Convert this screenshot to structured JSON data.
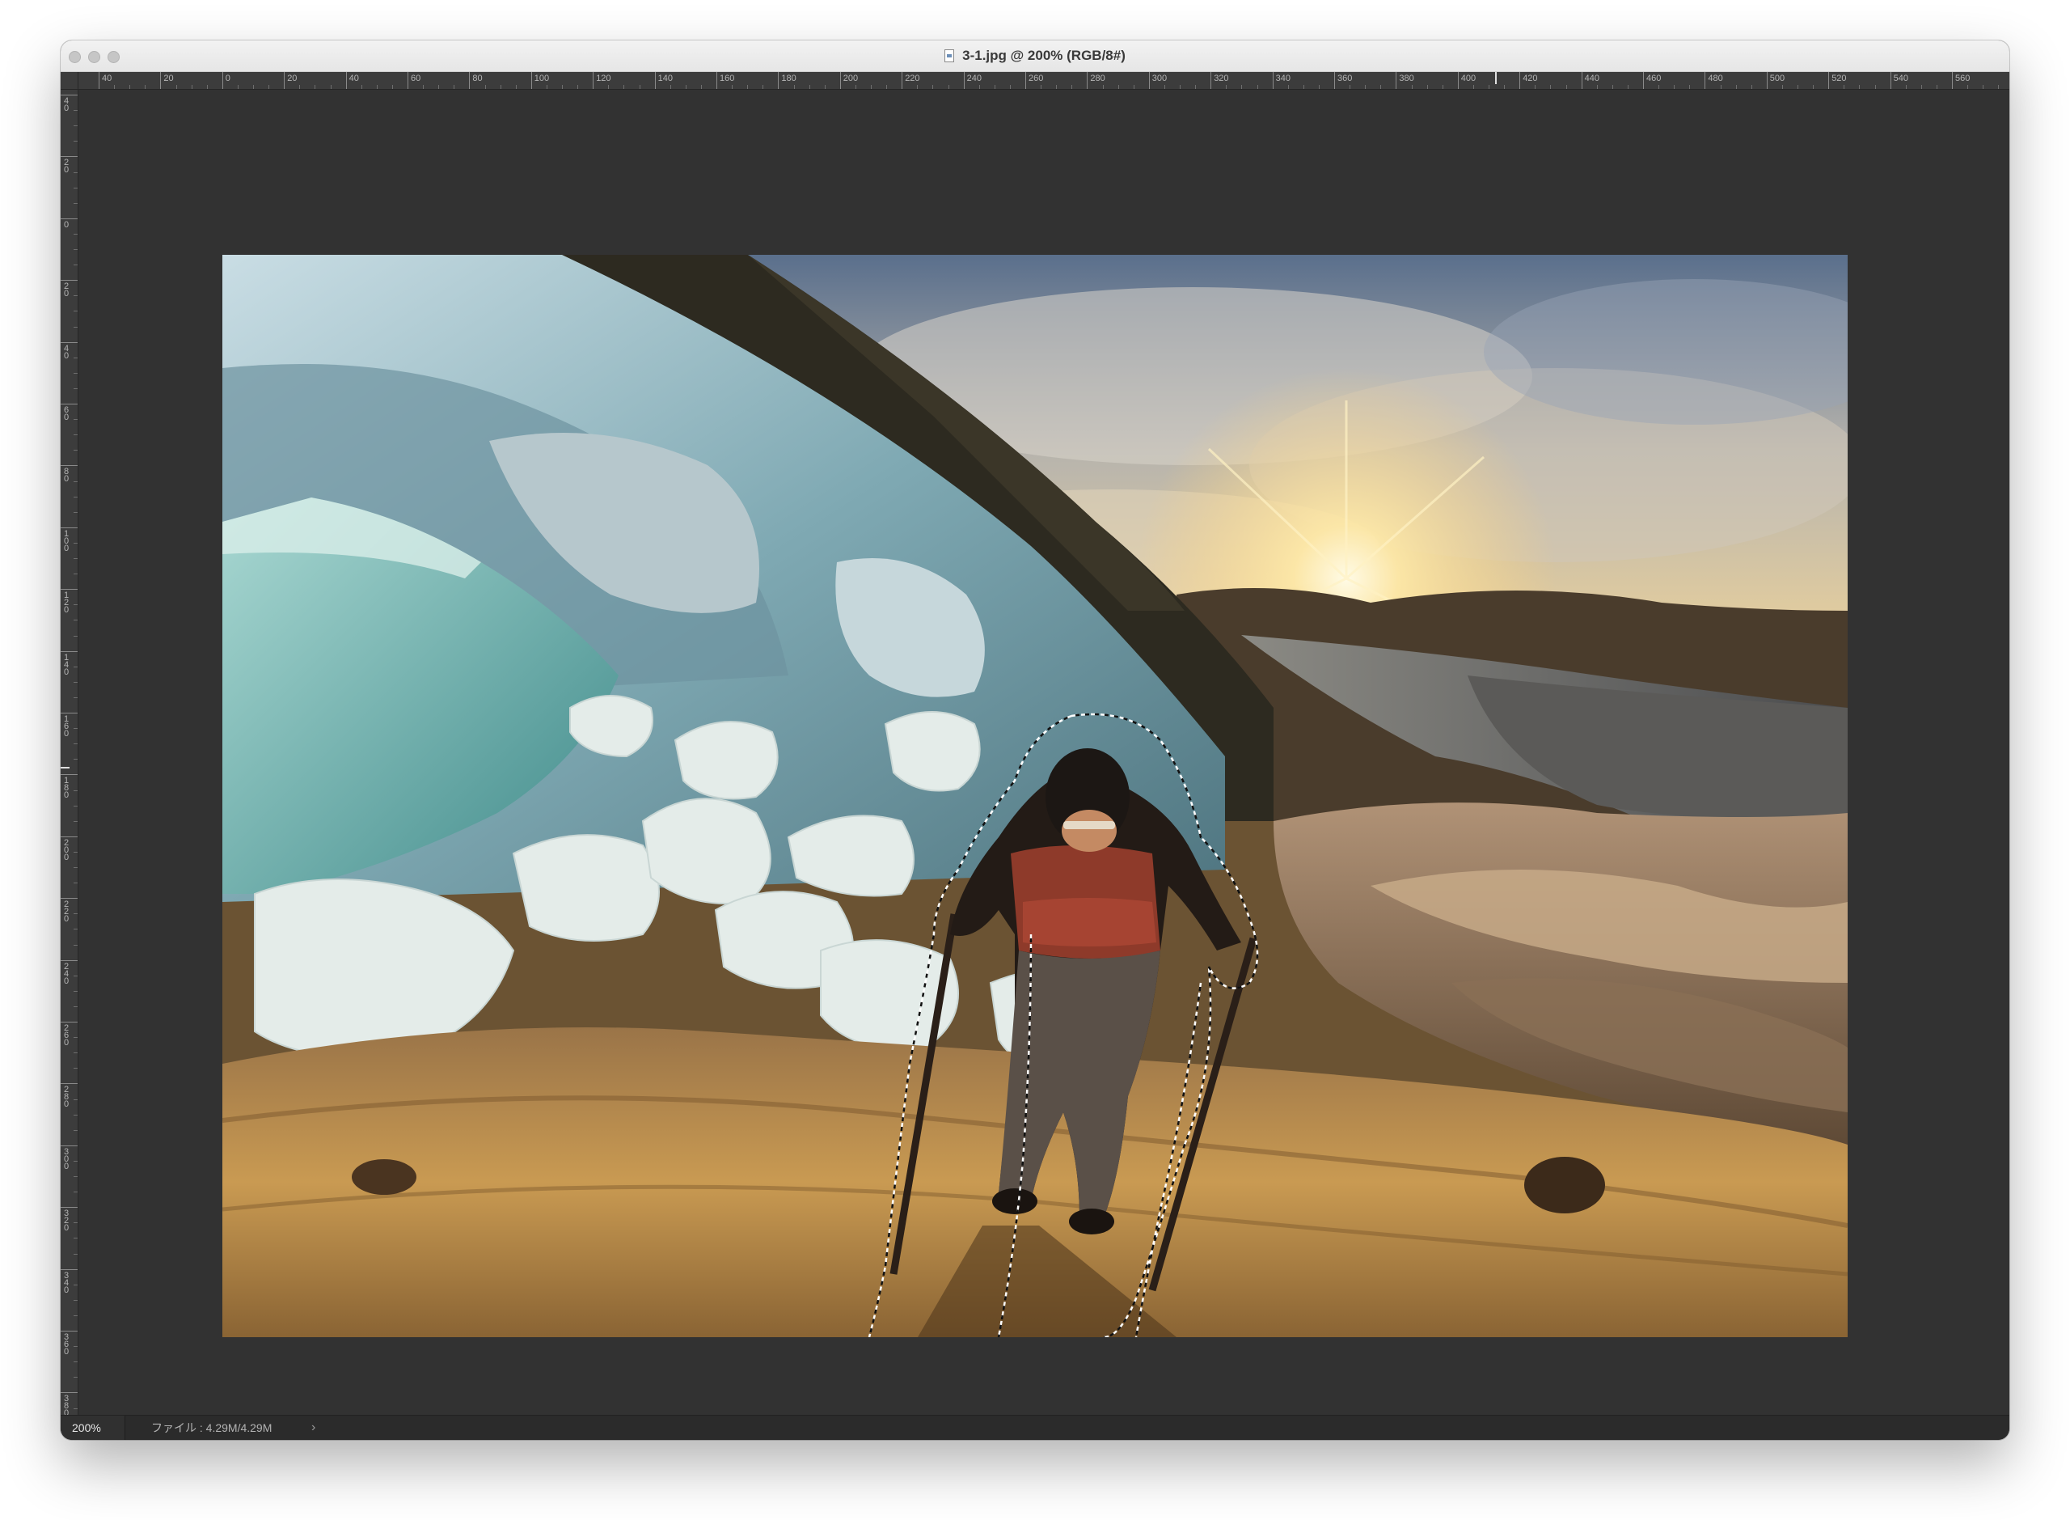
{
  "window": {
    "title": "3-1.jpg @ 200% (RGB/8#)",
    "doc_icon": "document-icon"
  },
  "rulers": {
    "horizontal_labels": [
      "40",
      "20",
      "0",
      "20",
      "40",
      "60",
      "80",
      "100",
      "120",
      "140",
      "160",
      "180",
      "200",
      "220",
      "240",
      "260",
      "280",
      "300",
      "320",
      "340",
      "360",
      "380",
      "400",
      "420",
      "440",
      "460",
      "480",
      "500",
      "520",
      "540",
      "560"
    ],
    "vertical_labels": [
      "40",
      "20",
      "0",
      "20",
      "40",
      "60",
      "80",
      "100",
      "120",
      "140",
      "160",
      "180",
      "200",
      "220",
      "240",
      "260",
      "280",
      "300",
      "320",
      "340",
      "360",
      "380"
    ]
  },
  "status": {
    "zoom": "200%",
    "file_info": "ファイル : 4.29M/4.29M",
    "more_icon": "chevron-right-icon",
    "more_glyph": "›"
  },
  "colors": {
    "canvas_bg": "#323232",
    "ruler_bg": "#3c3c3c",
    "selection": "marching-ants"
  }
}
